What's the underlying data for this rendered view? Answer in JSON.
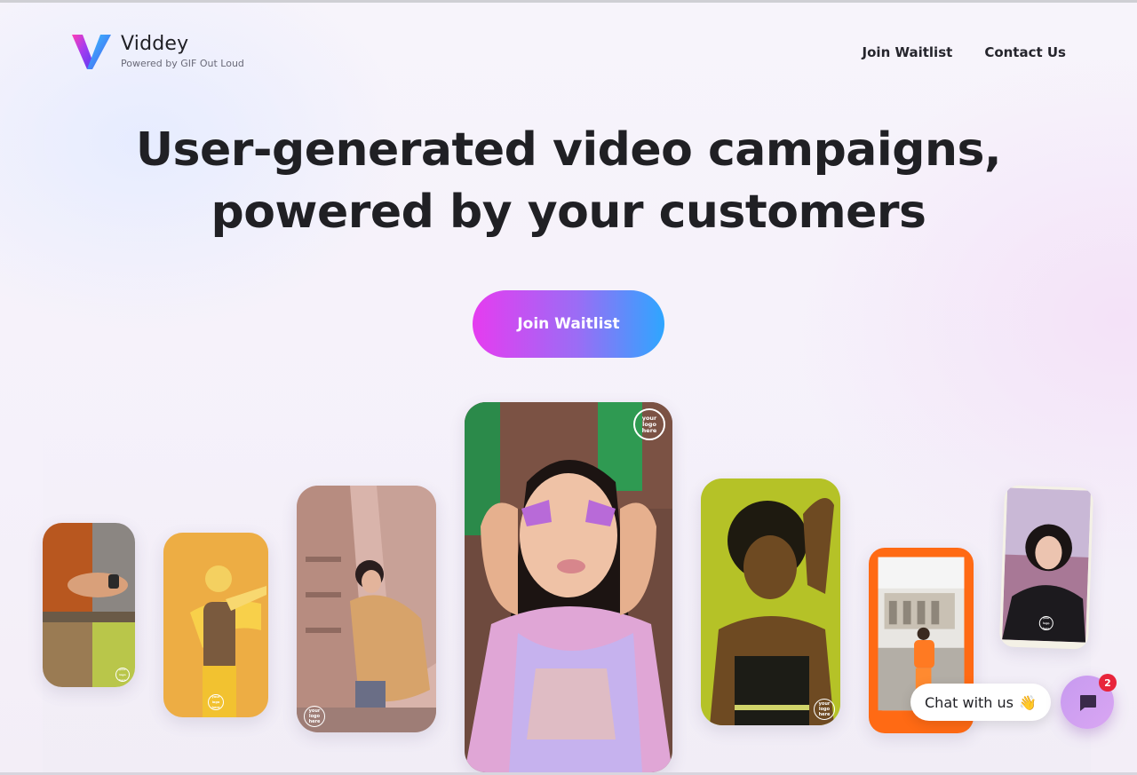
{
  "header": {
    "brand": "Viddey",
    "tagline": "Powered by GIF Out Loud",
    "nav": [
      {
        "label": "Join Waitlist"
      },
      {
        "label": "Contact Us"
      }
    ]
  },
  "hero": {
    "headline_line1": "User-generated video campaigns,",
    "headline_line2": "powered by your customers",
    "cta_label": "Join Waitlist"
  },
  "showcase": {
    "badge_text": "your logo here",
    "cards": [
      {
        "name": "video-card-1",
        "theme": "woodshop-orange-green"
      },
      {
        "name": "video-card-2",
        "theme": "dancer-yellow"
      },
      {
        "name": "video-card-3",
        "theme": "street-puffer-jacket"
      },
      {
        "name": "video-card-4",
        "theme": "featured-face-paint"
      },
      {
        "name": "video-card-5",
        "theme": "portrait-lime"
      },
      {
        "name": "video-card-6",
        "theme": "city-orange-frame"
      },
      {
        "name": "video-card-7",
        "theme": "selfie-leather-jacket"
      }
    ]
  },
  "chat": {
    "label": "Chat with us",
    "emoji": "👋",
    "unread_count": "2"
  },
  "colors": {
    "cta_start": "#e63cf0",
    "cta_end": "#2ea6ff",
    "chat_badge": "#e8243b"
  }
}
